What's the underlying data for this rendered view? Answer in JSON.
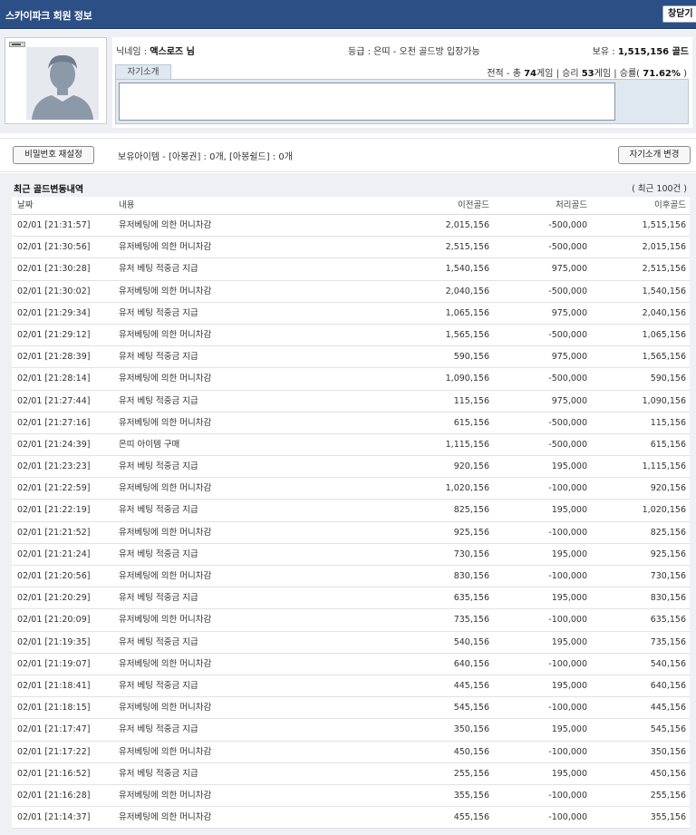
{
  "header": {
    "title": "스카이파크 회원 정보",
    "close_label": "창닫기"
  },
  "profile": {
    "nickname_label": "닉네임 : ",
    "nickname": "액스로즈 님",
    "grade_label": "등급 : ",
    "grade": "은띠",
    "grade_note": " - 오천 골드방 입장가능",
    "holding_label": "보유 : ",
    "holding": "1,515,156 골드",
    "stats_prefix": "전적 - 총 ",
    "total_games": "74",
    "games_unit": "게임 | 승리 ",
    "wins": "53",
    "wins_unit": "게임 | 승률( ",
    "win_rate": "71.62%",
    "stats_suffix": " )",
    "intro_tab": "자기소개",
    "intro_text": ""
  },
  "items": {
    "reset_password_label": "비밀번호 재설정",
    "items_text": "보유아이템 - [아봉권] : 0개, [아봉쉴드] : 0개",
    "edit_intro_label": "자기소개 변경"
  },
  "history": {
    "title": "최근 골드변동내역",
    "count": "( 최근 100건 )",
    "columns": {
      "date": "날짜",
      "desc": "내용",
      "prev": "이전골드",
      "proc": "처리골드",
      "after": "이후골드"
    },
    "rows": [
      {
        "date": "02/01 [21:31:57]",
        "desc": "유저베팅에 의한 머니차감",
        "prev": "2,015,156",
        "proc": "-500,000",
        "after": "1,515,156"
      },
      {
        "date": "02/01 [21:30:56]",
        "desc": "유저베팅에 의한 머니차감",
        "prev": "2,515,156",
        "proc": "-500,000",
        "after": "2,015,156"
      },
      {
        "date": "02/01 [21:30:28]",
        "desc": "유저 베팅 적중금 지급",
        "prev": "1,540,156",
        "proc": "975,000",
        "after": "2,515,156"
      },
      {
        "date": "02/01 [21:30:02]",
        "desc": "유저베팅에 의한 머니차감",
        "prev": "2,040,156",
        "proc": "-500,000",
        "after": "1,540,156"
      },
      {
        "date": "02/01 [21:29:34]",
        "desc": "유저 베팅 적중금 지급",
        "prev": "1,065,156",
        "proc": "975,000",
        "after": "2,040,156"
      },
      {
        "date": "02/01 [21:29:12]",
        "desc": "유저베팅에 의한 머니차감",
        "prev": "1,565,156",
        "proc": "-500,000",
        "after": "1,065,156"
      },
      {
        "date": "02/01 [21:28:39]",
        "desc": "유저 베팅 적중금 지급",
        "prev": "590,156",
        "proc": "975,000",
        "after": "1,565,156"
      },
      {
        "date": "02/01 [21:28:14]",
        "desc": "유저베팅에 의한 머니차감",
        "prev": "1,090,156",
        "proc": "-500,000",
        "after": "590,156"
      },
      {
        "date": "02/01 [21:27:44]",
        "desc": "유저 베팅 적중금 지급",
        "prev": "115,156",
        "proc": "975,000",
        "after": "1,090,156"
      },
      {
        "date": "02/01 [21:27:16]",
        "desc": "유저베팅에 의한 머니차감",
        "prev": "615,156",
        "proc": "-500,000",
        "after": "115,156"
      },
      {
        "date": "02/01 [21:24:39]",
        "desc": "은띠 아이템 구매",
        "prev": "1,115,156",
        "proc": "-500,000",
        "after": "615,156"
      },
      {
        "date": "02/01 [21:23:23]",
        "desc": "유저 베팅 적중금 지급",
        "prev": "920,156",
        "proc": "195,000",
        "after": "1,115,156"
      },
      {
        "date": "02/01 [21:22:59]",
        "desc": "유저베팅에 의한 머니차감",
        "prev": "1,020,156",
        "proc": "-100,000",
        "after": "920,156"
      },
      {
        "date": "02/01 [21:22:19]",
        "desc": "유저 베팅 적중금 지급",
        "prev": "825,156",
        "proc": "195,000",
        "after": "1,020,156"
      },
      {
        "date": "02/01 [21:21:52]",
        "desc": "유저베팅에 의한 머니차감",
        "prev": "925,156",
        "proc": "-100,000",
        "after": "825,156"
      },
      {
        "date": "02/01 [21:21:24]",
        "desc": "유저 베팅 적중금 지급",
        "prev": "730,156",
        "proc": "195,000",
        "after": "925,156"
      },
      {
        "date": "02/01 [21:20:56]",
        "desc": "유저베팅에 의한 머니차감",
        "prev": "830,156",
        "proc": "-100,000",
        "after": "730,156"
      },
      {
        "date": "02/01 [21:20:29]",
        "desc": "유저 베팅 적중금 지급",
        "prev": "635,156",
        "proc": "195,000",
        "after": "830,156"
      },
      {
        "date": "02/01 [21:20:09]",
        "desc": "유저베팅에 의한 머니차감",
        "prev": "735,156",
        "proc": "-100,000",
        "after": "635,156"
      },
      {
        "date": "02/01 [21:19:35]",
        "desc": "유저 베팅 적중금 지급",
        "prev": "540,156",
        "proc": "195,000",
        "after": "735,156"
      },
      {
        "date": "02/01 [21:19:07]",
        "desc": "유저베팅에 의한 머니차감",
        "prev": "640,156",
        "proc": "-100,000",
        "after": "540,156"
      },
      {
        "date": "02/01 [21:18:41]",
        "desc": "유저 베팅 적중금 지급",
        "prev": "445,156",
        "proc": "195,000",
        "after": "640,156"
      },
      {
        "date": "02/01 [21:18:15]",
        "desc": "유저베팅에 의한 머니차감",
        "prev": "545,156",
        "proc": "-100,000",
        "after": "445,156"
      },
      {
        "date": "02/01 [21:17:47]",
        "desc": "유저 베팅 적중금 지급",
        "prev": "350,156",
        "proc": "195,000",
        "after": "545,156"
      },
      {
        "date": "02/01 [21:17:22]",
        "desc": "유저베팅에 의한 머니차감",
        "prev": "450,156",
        "proc": "-100,000",
        "after": "350,156"
      },
      {
        "date": "02/01 [21:16:52]",
        "desc": "유저 베팅 적중금 지급",
        "prev": "255,156",
        "proc": "195,000",
        "after": "450,156"
      },
      {
        "date": "02/01 [21:16:28]",
        "desc": "유저베팅에 의한 머니차감",
        "prev": "355,156",
        "proc": "-100,000",
        "after": "255,156"
      },
      {
        "date": "02/01 [21:14:37]",
        "desc": "유저베팅에 의한 머니차감",
        "prev": "455,156",
        "proc": "-100,000",
        "after": "355,156"
      }
    ]
  }
}
